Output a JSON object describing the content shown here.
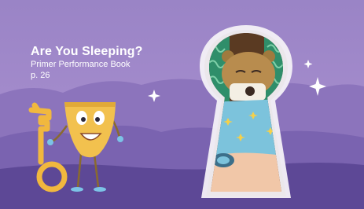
{
  "slide": {
    "title": "Are You Sleeping?",
    "subtitle": "Primer Performance Book",
    "page_ref": "p. 26"
  },
  "colors": {
    "sky_top": "#9a84c6",
    "hills_back": "#8c74bc",
    "hills_front": "#6f58a6",
    "ground": "#5d4896",
    "keyhole_frame": "#f4f1f7",
    "keyhole_inner": "#5a3a22",
    "bear_fur": "#b88c4e",
    "blanket": "#7cc3dc",
    "cup_yellow": "#f2c14e",
    "key_yellow": "#f1b83e"
  },
  "icons": [
    "key-icon",
    "cup-character",
    "keyhole-icon",
    "sparkle-icon",
    "sleeping-bear-illustration"
  ]
}
